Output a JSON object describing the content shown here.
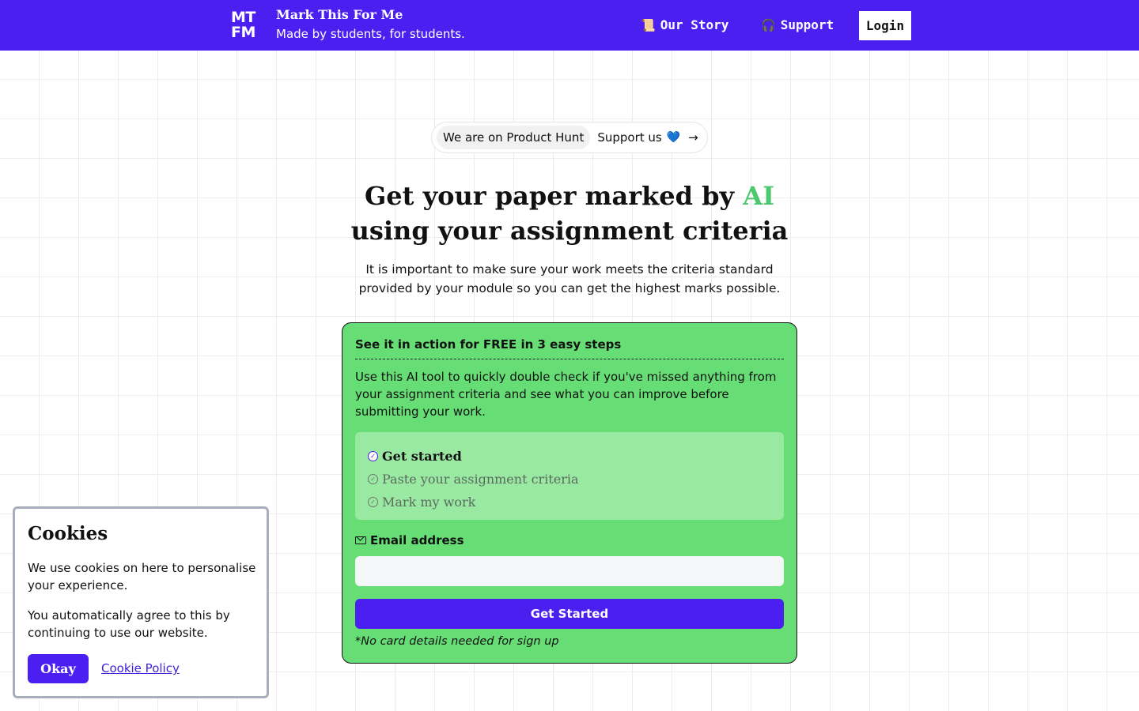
{
  "colors": {
    "brand": "#4b1ff0",
    "accent_green": "#4cc96e",
    "card_green": "#66de75",
    "steps_green": "#9ae9a2",
    "link": "#3b1fd6"
  },
  "header": {
    "logo_line1": "MT",
    "logo_line2": "FM",
    "title": "Mark This For Me",
    "tagline": "Made by students, for students.",
    "nav": [
      {
        "icon": "📜",
        "label": "Our Story"
      },
      {
        "icon": "🎧",
        "label": "Support"
      }
    ],
    "login_label": "Login"
  },
  "product_hunt": {
    "tag": "We are on Product Hunt",
    "support_label": "Support us",
    "heart": "💙",
    "arrow": "→"
  },
  "hero": {
    "title_part1": "Get your paper marked by ",
    "title_accent": "AI",
    "title_part2": "using your assignment criteria",
    "subtitle": "It is important to make sure your work meets the criteria standard provided by your module so you can get the highest marks possible."
  },
  "card": {
    "heading": "See it in action for FREE in 3 easy steps",
    "description": "Use this AI tool to quickly double check if you've missed anything from your assignment criteria and see what you can improve before submitting your work.",
    "steps": [
      {
        "label": "Get started",
        "active": true
      },
      {
        "label": "Paste your assignment criteria",
        "active": false
      },
      {
        "label": "Mark my work",
        "active": false
      }
    ],
    "email_label": "Email address",
    "email_value": "",
    "email_placeholder": "",
    "button_label": "Get Started",
    "note": "*No card details needed for sign up"
  },
  "cookies": {
    "title": "Cookies",
    "text1": "We use cookies on here to personalise your experience.",
    "text2": "You automatically agree to this by continuing to use our website.",
    "okay_label": "Okay",
    "policy_link": "Cookie Policy"
  }
}
